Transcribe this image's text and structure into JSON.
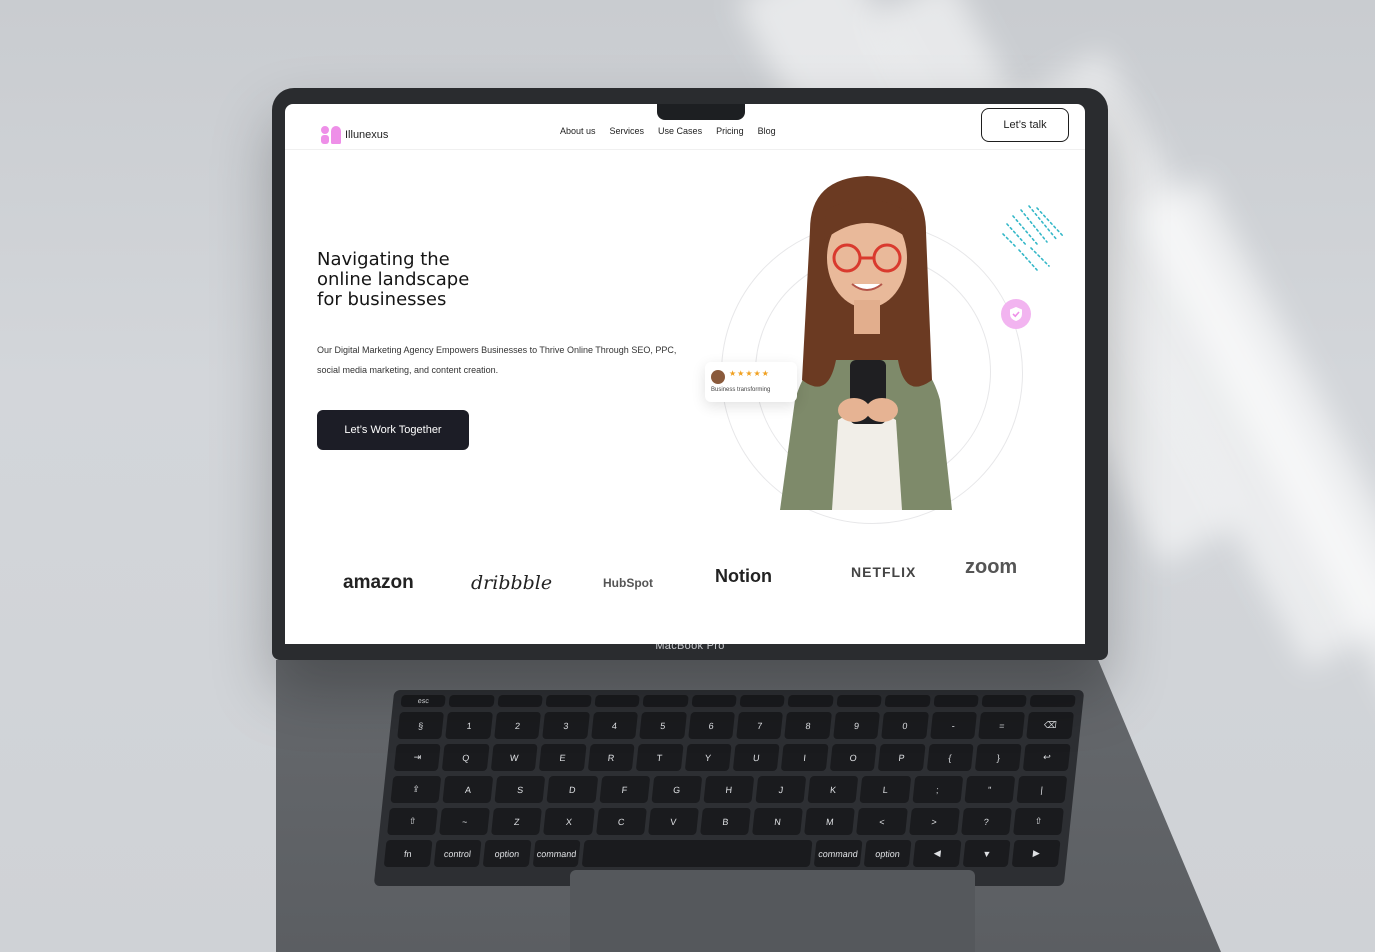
{
  "device": {
    "label": "MacBook Pro"
  },
  "nav": {
    "logo_text": "Illunexus",
    "links": [
      "About us",
      "Services",
      "Use Cases",
      "Pricing",
      "Blog"
    ],
    "cta": "Let’s talk"
  },
  "hero": {
    "title_lines": [
      "Navigating the",
      "online landscape",
      "for businesses"
    ],
    "subtitle": "Our Digital Marketing Agency Empowers Businesses to Thrive Online Through SEO, PPC, social media marketing, and content creation.",
    "cta": "Let’s Work Together",
    "review": {
      "stars": "★★★★★",
      "text": "Business transforming"
    }
  },
  "partners": [
    "amazon",
    "dribbble",
    "HubSpot",
    "Notion",
    "NETFLIX",
    "zoom"
  ],
  "keyboard": {
    "rows": [
      [
        "esc",
        "",
        "",
        "",
        "",
        "",
        "",
        "",
        "",
        "",
        "",
        "",
        "",
        ""
      ],
      [
        "§",
        "1",
        "2",
        "3",
        "4",
        "5",
        "6",
        "7",
        "8",
        "9",
        "0",
        "-",
        "=",
        "⌫"
      ],
      [
        "⇥",
        "Q",
        "W",
        "E",
        "R",
        "T",
        "Y",
        "U",
        "I",
        "O",
        "P",
        "{",
        "}",
        "↩"
      ],
      [
        "⇪",
        "A",
        "S",
        "D",
        "F",
        "G",
        "H",
        "J",
        "K",
        "L",
        ";",
        "\"",
        "|"
      ],
      [
        "⇧",
        "~",
        "Z",
        "X",
        "C",
        "V",
        "B",
        "N",
        "M",
        "<",
        ">",
        "?",
        "⇧"
      ],
      [
        "fn",
        "control",
        "option",
        "command",
        "",
        "command",
        "option",
        "◀",
        "▼",
        "▶"
      ]
    ]
  },
  "colors": {
    "accent": "#ee8fe8",
    "dark": "#1c1d26",
    "teal": "#35b8c8"
  }
}
